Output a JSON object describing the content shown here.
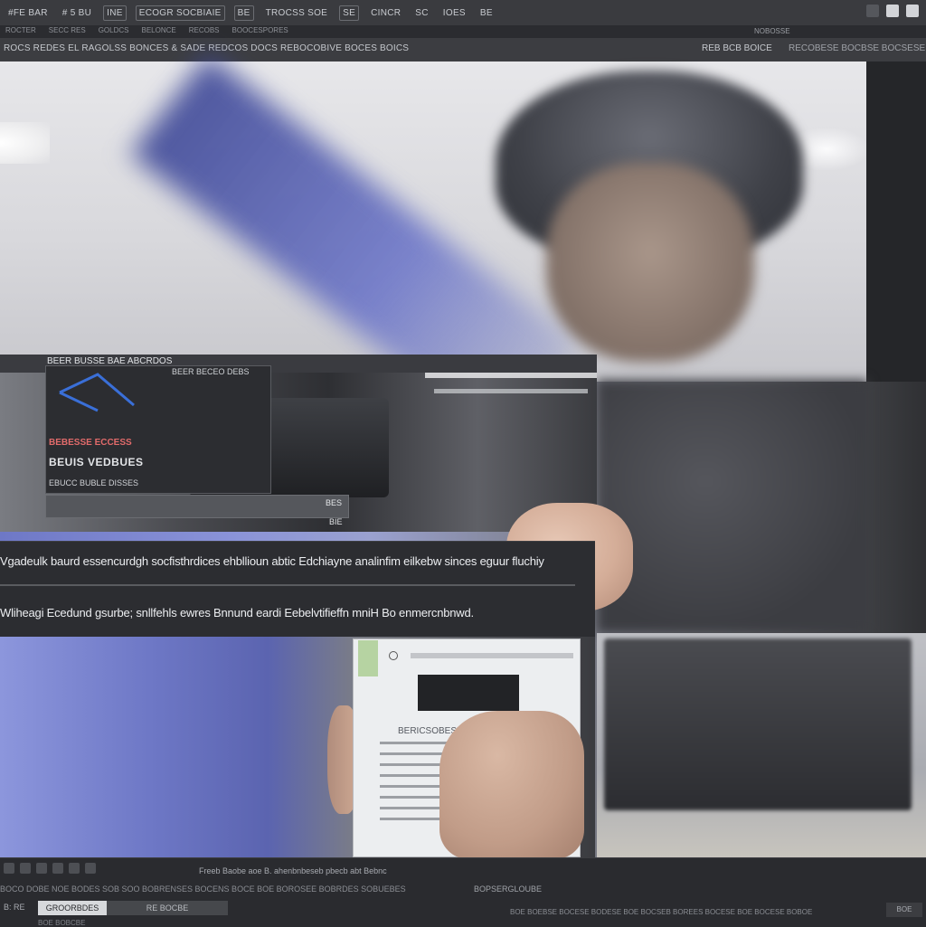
{
  "menu": {
    "items": [
      "#FE BAR",
      "# 5 BU",
      "INE",
      "ECOGR SOCBIAIE",
      "BE",
      "TROCSS SOE",
      "SE",
      "CINCR",
      "SC",
      "IOES",
      "BE"
    ]
  },
  "subtabs": [
    "ROCTER",
    "SECC RES",
    "GOLDCS",
    "BELONCE",
    "RECOBS",
    "BOOCESPORES"
  ],
  "panel_label": "NOBOSSE",
  "toolbar": {
    "left_text": "ROCS REDES EL RAGOLSS BONCES & SADE REDCOS DOCS  REBOCOBIVE BOCES BOICS",
    "right_text": "REB  BCB BOICE",
    "right_text2": "RECOBESE BOCBSE BOCSESE"
  },
  "overlay": {
    "strip_title": "BEER BUSSE BAE ABCRDOS",
    "strip_sub": "BEER BECEO DEBS",
    "inner_line1": "BEBESSE ECCESS",
    "inner_line2": "BEUIS VEDBUES",
    "inner_line3": "EBUCC BUBLE DISSES",
    "time_top": "BES",
    "time_bottom": "BIE"
  },
  "captions": {
    "line1": "Vgadeulk baurd essencurdgh socfisthrdices ehbllioun abtic Edchiayne analinfim eilkebw sinces eguur fluchiy",
    "line2": "Wliheagi Ecedund gsurbe; snllfehls ewres Bnnund eardi Eebelvtifieffn mniH Bo enmercnbnwd."
  },
  "document": {
    "small_text": "BERICSOBESE"
  },
  "status": {
    "text": "Freeb Baobe aoe B. ahenbnbeseb pbecb abt Bebnc",
    "line2": "BOCO DOBE NOE BODES SOB SOO BOBRENSES BOCENS BOCE BOE BOROSEE BOBRDES SOBUEBES",
    "line2b": "BOPSERGLOUBE",
    "left_label": "B: RE",
    "tab_active": "GROORBDES",
    "tab_inactive": "RE BOCBE",
    "line3": "BOE BOBCBE",
    "line4": "BOE BOEBSE BOCESE BODESE BOE BOCSEB BOREES BOCESE BOE BOCESE BOBOE",
    "button": "BOE"
  },
  "colors": {
    "chrome_dark": "#2a2b2f",
    "toolbar": "#3c3d41",
    "accent_blue": "#3a6fd8",
    "caption_bg": "#2c2d31",
    "caption_text": "#eceef1"
  }
}
